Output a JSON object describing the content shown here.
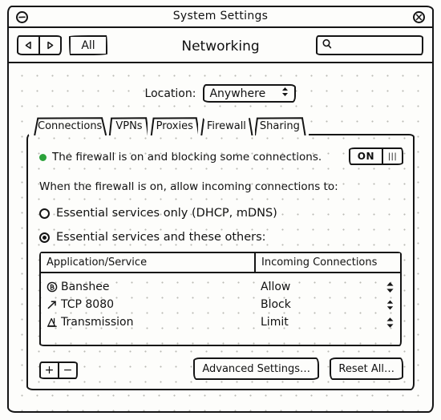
{
  "window": {
    "title": "System Settings",
    "minimize_icon": "minimize-circle-icon",
    "close_icon": "close-circle-icon"
  },
  "toolbar": {
    "back_icon": "triangle-left-icon",
    "forward_icon": "triangle-right-icon",
    "all_label": "All",
    "page_title": "Networking",
    "search_icon": "search-icon",
    "search_value": "",
    "search_placeholder": ""
  },
  "location": {
    "label": "Location:",
    "value": "Anywhere",
    "stepper_icon": "updown-arrows-icon",
    "options": [
      "Anywhere"
    ]
  },
  "tabs": [
    {
      "label": "Connections",
      "active": false
    },
    {
      "label": "VPNs",
      "active": false
    },
    {
      "label": "Proxies",
      "active": false
    },
    {
      "label": "Firewall",
      "active": true
    },
    {
      "label": "Sharing",
      "active": false
    }
  ],
  "firewall": {
    "status_text": "The firewall is on and blocking some connections.",
    "status_dot_color": "#2ba23a",
    "toggle_label": "ON",
    "toggle_knob_glyph": "|||",
    "prompt": "When the firewall is on, allow incoming connections to:",
    "options": [
      {
        "label": "Essential services only (DHCP, mDNS)",
        "selected": false
      },
      {
        "label": "Essential services and these others:",
        "selected": true
      }
    ]
  },
  "table": {
    "columns": [
      "Application/Service",
      "Incoming Connections"
    ],
    "rows": [
      {
        "icon": "banshee-app-icon",
        "name": "Banshee",
        "connection": "Allow",
        "stepper_icon": "updown-arrows-icon"
      },
      {
        "icon": "port-arrow-icon",
        "name": "TCP 8080",
        "connection": "Block",
        "stepper_icon": "updown-arrows-icon"
      },
      {
        "icon": "transmission-app-icon",
        "name": "Transmission",
        "connection": "Limit",
        "stepper_icon": "updown-arrows-icon"
      }
    ]
  },
  "footer": {
    "add_label": "+",
    "remove_label": "−",
    "advanced_settings_label": "Advanced Settings…",
    "reset_all_label": "Reset All…"
  }
}
